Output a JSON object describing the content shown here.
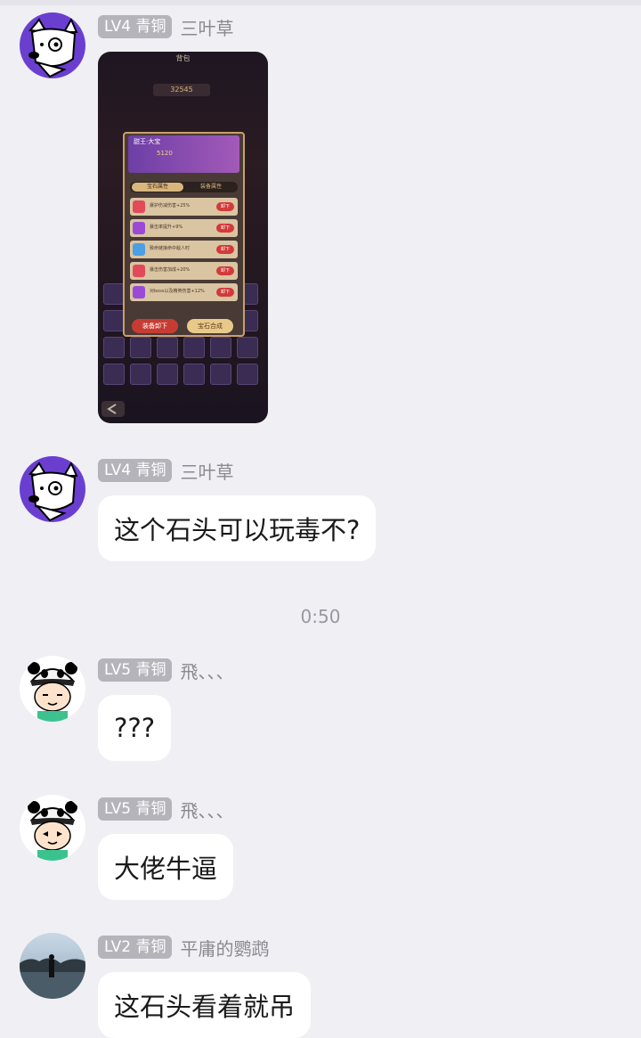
{
  "messages": [
    {
      "level_badge": "LV4 青铜",
      "nickname": "三叶草",
      "avatar": "dog-avatar",
      "kind": "image",
      "image": {
        "title": "背包",
        "score": "32545",
        "panel_title": "甜王·大宝",
        "panel_value": "5120",
        "tab_active": "宝石属性",
        "tab_inactive": "装备属性",
        "rows": [
          {
            "text": "暴护伤减伤害+25%",
            "button": "卸下"
          },
          {
            "text": "暴击率提升+9%",
            "button": "卸下"
          },
          {
            "text": "致命链接命中敌人时",
            "button": "卸下"
          },
          {
            "text": "暴击伤害加成+20%",
            "button": "卸下"
          },
          {
            "text": "对boss以及精英伤害+12%",
            "button": "卸下"
          }
        ],
        "button_unequip": "装备卸下",
        "button_synth": "宝石合成"
      }
    },
    {
      "level_badge": "LV4 青铜",
      "nickname": "三叶草",
      "avatar": "dog-avatar",
      "kind": "text",
      "text": "这个石头可以玩毒不?"
    },
    {
      "level_badge": "LV5 青铜",
      "nickname": "飛、、、",
      "avatar": "panda-boy-avatar",
      "kind": "text",
      "text": "???"
    },
    {
      "level_badge": "LV5 青铜",
      "nickname": "飛、、、",
      "avatar": "panda-boy-avatar",
      "kind": "text",
      "text": "大佬牛逼"
    },
    {
      "level_badge": "LV2 青铜",
      "nickname": "平庸的鹦鹉",
      "avatar": "lake-photo-avatar",
      "kind": "text",
      "text": "这石头看着就吊"
    }
  ],
  "timestamp": "0:50",
  "colors": {
    "background": "#efeff4",
    "bubble": "#ffffff",
    "badge": "#b4b4ba",
    "nickname": "#8a8a8f"
  }
}
